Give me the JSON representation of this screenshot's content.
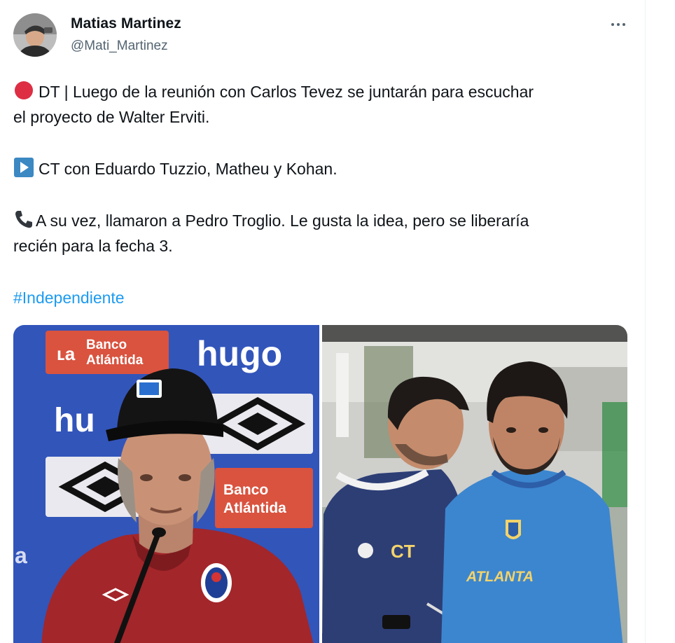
{
  "tweet": {
    "author": {
      "name": "Matias Martinez",
      "handle": "@Mati_Martinez",
      "avatar_icon": "profile-photo"
    },
    "more_icon": "more-horizontal-icon",
    "paragraphs": {
      "p1_line1": "DT | Luego de la reunión con Carlos Tevez se juntarán para escuchar",
      "p1_line2": "el proyecto de Walter Erviti.",
      "p2_line1": "CT con Eduardo Tuzzio, Matheu y Kohan.",
      "p3_line1": "A su vez, llamaron a Pedro Troglio. Le gusta la idea, pero se liberaría",
      "p3_line2": "recién para la fecha 3.",
      "hashtag": "#Independiente"
    },
    "emoji": {
      "p1": "red-circle-icon",
      "p2": "play-button-icon",
      "p3": "telephone-receiver-icon"
    },
    "media": {
      "left": {
        "backdrop_texts": [
          "Banco Atlántida",
          "hugo",
          "hu",
          "Banco Atlántida",
          "a"
        ],
        "cap_badge": "IFC"
      },
      "right": {
        "shirt_text_left": "CT",
        "shirt_text_right": "ATLANTA"
      }
    },
    "colors": {
      "hashtag": "#1d9bf0",
      "text": "#0f1419",
      "secondary": "#536471"
    }
  }
}
